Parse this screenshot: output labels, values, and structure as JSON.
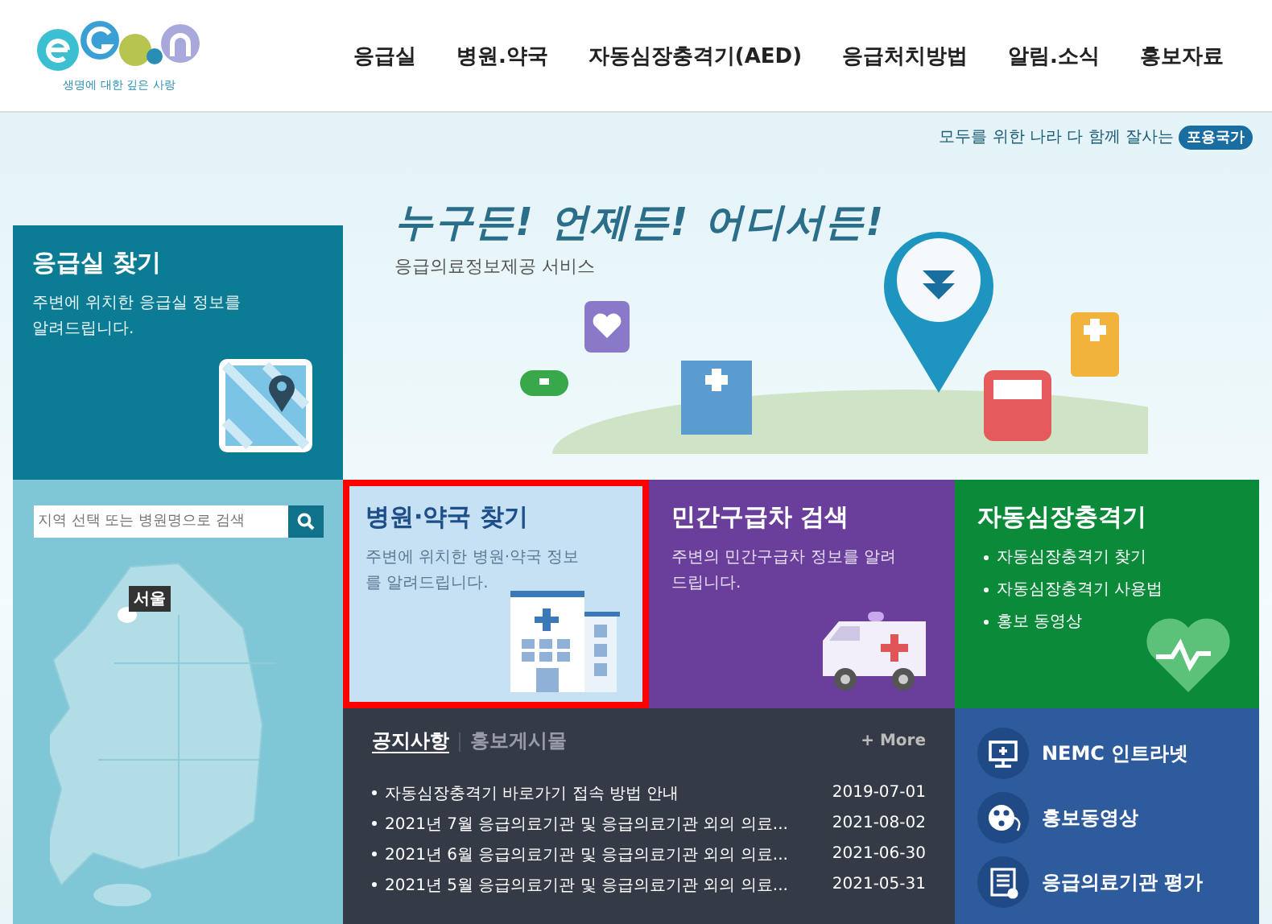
{
  "logo": {
    "tagline": "생명에 대한 깊은 사랑"
  },
  "nav": [
    {
      "label": "응급실"
    },
    {
      "label": "병원.약국"
    },
    {
      "label": "자동심장충격기(AED)"
    },
    {
      "label": "응급처치방법"
    },
    {
      "label": "알림.소식"
    },
    {
      "label": "홍보자료"
    }
  ],
  "hero": {
    "slogan": "모두를 위한 나라 다 함께 잘사는",
    "slogan_badge": "포용국가",
    "headline": "누구든! 언제든! 어디서든!",
    "subtitle": "응급의료정보제공 서비스"
  },
  "er_card": {
    "title": "응급실 찾기",
    "description": "주변에 위치한 응급실 정보를 알려드립니다."
  },
  "map_panel": {
    "search": {
      "placeholder": "지역 선택 또는 병원명으로 검색"
    },
    "region_label": "서울"
  },
  "cards": [
    {
      "kind": "hospital",
      "title": "병원·약국 찾기",
      "description": "주변에 위치한 병원·약국 정보를 알려드립니다.",
      "highlighted": true
    },
    {
      "kind": "ambulance",
      "title": "민간구급차 검색",
      "description": "주변의 민간구급차 정보를 알려드립니다.",
      "highlighted": false
    },
    {
      "kind": "aed",
      "title": "자동심장충격기",
      "links": [
        "자동심장충격기 찾기",
        "자동심장충격기 사용법",
        "홍보 동영상"
      ],
      "highlighted": false
    }
  ],
  "notices": {
    "tabs": [
      {
        "label": "공지사항",
        "selected": true
      },
      {
        "label": "홍보게시물",
        "selected": false
      }
    ],
    "more": "+ More",
    "rows": [
      {
        "title": "자동심장충격기 바로가기 접속 방법 안내",
        "date": "2019-07-01"
      },
      {
        "title": "2021년 7월 응급의료기관 및 응급의료기관 외의 의료...",
        "date": "2021-08-02"
      },
      {
        "title": "2021년 6월 응급의료기관 및 응급의료기관 외의 의료...",
        "date": "2021-06-30"
      },
      {
        "title": "2021년 5월 응급의료기관 및 응급의료기관 외의 의료...",
        "date": "2021-05-31"
      }
    ]
  },
  "quick_links": [
    {
      "kind": "monitor",
      "label": "NEMC 인트라넷"
    },
    {
      "kind": "film",
      "label": "홍보동영상"
    },
    {
      "kind": "document",
      "label": "응급의료기관 평가"
    }
  ]
}
